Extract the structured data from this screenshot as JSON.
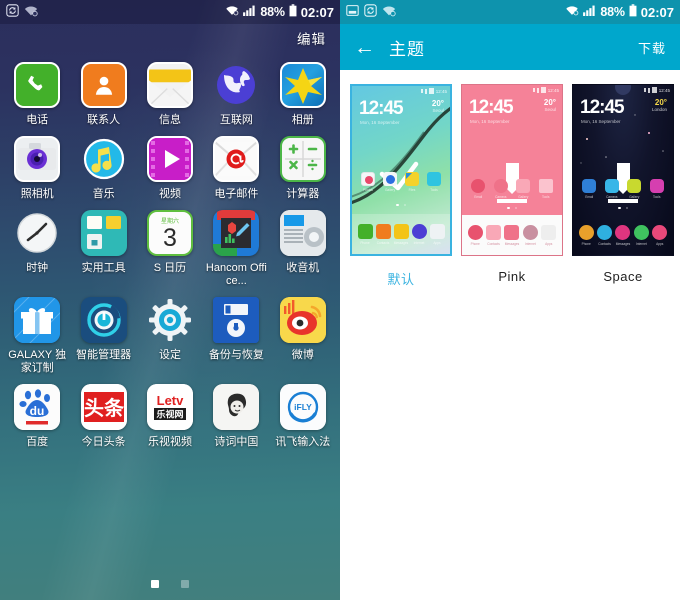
{
  "left_phone": {
    "statusbar": {
      "icons": [
        "sync-icon",
        "wifi-alert-icon"
      ],
      "wifi": "wifi-icon",
      "signal": "signal-bars-icon",
      "battery_percent": "88%",
      "battery": "battery-icon",
      "time": "02:07"
    },
    "edit_label": "编辑",
    "apps": [
      {
        "label": "电话",
        "icon": "phone-icon"
      },
      {
        "label": "联系人",
        "icon": "contacts-icon"
      },
      {
        "label": "信息",
        "icon": "messages-icon"
      },
      {
        "label": "互联网",
        "icon": "internet-globe-icon"
      },
      {
        "label": "相册",
        "icon": "gallery-icon"
      },
      {
        "label": "照相机",
        "icon": "camera-icon"
      },
      {
        "label": "音乐",
        "icon": "music-note-icon"
      },
      {
        "label": "视频",
        "icon": "video-play-icon"
      },
      {
        "label": "电子邮件",
        "icon": "email-icon"
      },
      {
        "label": "计算器",
        "icon": "calculator-icon"
      },
      {
        "label": "时钟",
        "icon": "clock-icon"
      },
      {
        "label": "实用工具",
        "icon": "tools-folder-icon"
      },
      {
        "label": "S 日历",
        "icon": "calendar-icon"
      },
      {
        "label": "Hancom Office...",
        "icon": "hancom-office-icon"
      },
      {
        "label": "收音机",
        "icon": "radio-icon"
      },
      {
        "label": "GALAXY 独家订制",
        "icon": "gift-icon"
      },
      {
        "label": "智能管理器",
        "icon": "smart-manager-icon"
      },
      {
        "label": "设定",
        "icon": "settings-gear-icon"
      },
      {
        "label": "备份与恢复",
        "icon": "backup-restore-icon"
      },
      {
        "label": "微博",
        "icon": "weibo-icon"
      },
      {
        "label": "百度",
        "icon": "baidu-icon"
      },
      {
        "label": "今日头条",
        "icon": "toutiao-icon"
      },
      {
        "label": "乐视视频",
        "icon": "letv-icon"
      },
      {
        "label": "诗词中国",
        "icon": "shici-china-icon"
      },
      {
        "label": "讯飞输入法",
        "icon": "ifly-icon"
      }
    ],
    "calendar_weekday": "星期六",
    "calendar_day": "3",
    "page_indicator": {
      "total": 2,
      "active": 1
    },
    "colors": {
      "wallpaper_top": "#2b2e5c",
      "wallpaper_bottom": "#427f7d"
    }
  },
  "right_phone": {
    "statusbar": {
      "icons": [
        "screenshot-icon",
        "sync-icon",
        "wifi-alert-icon"
      ],
      "battery_percent": "88%",
      "time": "02:07"
    },
    "appbar": {
      "back": "back-arrow-icon",
      "title": "主题",
      "action": "下载"
    },
    "themes": [
      {
        "name": "默认",
        "selected": true,
        "clock": "12:45",
        "date": "Mon, 16 September",
        "temp": "20°",
        "city": "Seoul",
        "apps": [
          "Photos",
          "Gallery",
          "Files",
          "Tools"
        ],
        "dock": [
          "Phone",
          "Contacts",
          "Messages",
          "Internet",
          "Apps"
        ],
        "has_download_arrow": false
      },
      {
        "name": "Pink",
        "selected": false,
        "clock": "12:45",
        "date": "Mon, 16 September",
        "temp": "20°",
        "city": "Seoul",
        "apps": [
          "Email",
          "Camera",
          "Gallery",
          "Tools"
        ],
        "dock": [
          "Phone",
          "Contacts",
          "Messages",
          "Internet",
          "Apps"
        ],
        "has_download_arrow": true
      },
      {
        "name": "Space",
        "selected": false,
        "clock": "12:45",
        "date": "Mon, 16 September",
        "temp": "20°",
        "city": "London",
        "apps": [
          "Email",
          "Camera",
          "Gallery",
          "Tools"
        ],
        "dock": [
          "Phone",
          "Contacts",
          "Messages",
          "Internet",
          "Apps"
        ],
        "has_download_arrow": true
      }
    ],
    "colors": {
      "statusbar": "#0e93ad",
      "appbar": "#00a7cc",
      "accent": "#3ab3e0"
    }
  }
}
